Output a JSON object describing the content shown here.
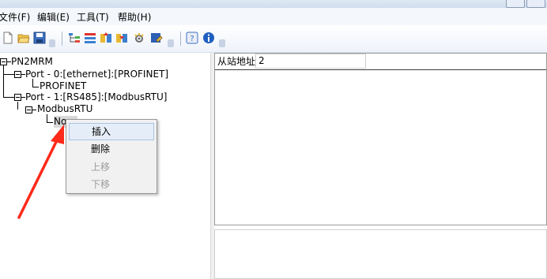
{
  "menu": {
    "file": "文件(F)",
    "edit": "编辑(E)",
    "tools": "工具(T)",
    "help": "帮助(H)"
  },
  "toolbar": {
    "icons": [
      "new-file-icon",
      "open-folder-icon",
      "save-icon",
      "tree-view-icon",
      "list-icon",
      "upload-icon",
      "download-icon",
      "settings-icon",
      "edit-icon",
      "help-icon",
      "info-icon"
    ]
  },
  "tree": {
    "root": "PN2MRM",
    "port0": "Port - 0:[ethernet]:[PROFINET]",
    "profinet": "PROFINET",
    "port1": "Port - 1:[RS485]:[ModbusRTU]",
    "modbus": "ModbusRTU",
    "node": "No..."
  },
  "properties": {
    "label": "从站地址",
    "value": "2"
  },
  "context_menu": {
    "insert": "插入",
    "delete": "删除",
    "move_up": "上移",
    "move_down": "下移"
  },
  "colors": {
    "annotation_arrow": "#ff2a1a",
    "menu_hover": "#e5eef8",
    "tree_selection": "#d9d9d9"
  }
}
